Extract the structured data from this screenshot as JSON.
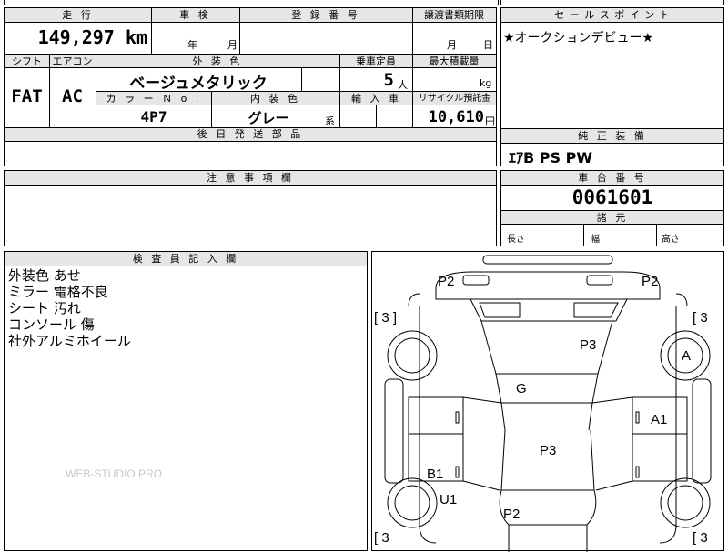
{
  "top_strip": {
    "cut_text": "輸入車"
  },
  "mileage": {
    "header": "走 行",
    "value": "149,297",
    "unit": "km"
  },
  "inspection": {
    "header": "車 検",
    "year_label": "年",
    "month_label": "月"
  },
  "registration": {
    "header": "登 録 番 号"
  },
  "transfer": {
    "header": "譲渡書類期限",
    "month_label": "月",
    "day_label": "日"
  },
  "sales_point": {
    "header": "セ ー ル ス ポ イ ン ト",
    "text": "★オークションデビュー★"
  },
  "shift": {
    "header": "シフト",
    "value": "FAT"
  },
  "aircon": {
    "header": "エアコン",
    "value": "AC"
  },
  "exterior_color": {
    "header": "外 装 色",
    "value": "ベージュメタリック"
  },
  "capacity": {
    "header": "乗車定員",
    "value": "5",
    "unit": "人"
  },
  "max_load": {
    "header": "最大積載量",
    "unit": "kg"
  },
  "color_no": {
    "header": "カ ラ ー Ｎ o .",
    "value": "4P7"
  },
  "interior_color": {
    "header": "内 装 色",
    "value": "グレー",
    "suffix": "系"
  },
  "import_car": {
    "header": "輸 入 車"
  },
  "recycle": {
    "header": "リサイクル預託金",
    "value": "10,610",
    "unit": "円"
  },
  "parts_later": {
    "header": "後 日 発 送 部 品"
  },
  "genuine_equip": {
    "header": "純 正 装 備",
    "value": "ｴｱB PS PW"
  },
  "notes": {
    "header": "注 意 事 項 欄"
  },
  "chassis": {
    "header": "車 台 番 号",
    "value": "0061601"
  },
  "dimensions": {
    "header": "諸 元",
    "length": "長さ",
    "width": "幅",
    "height": "高さ"
  },
  "inspector": {
    "header": "検 査 員 記 入 欄",
    "lines": [
      "外装色 あせ",
      "ミラー 電格不良",
      "シート 汚れ",
      "コンソール 傷",
      "社外アルミホイール"
    ]
  },
  "watermark": "WEB-STUDIO.PRO",
  "diagram": {
    "p2_left": "P2",
    "p2_right": "P2",
    "bracket_tl": "[ 3 ]",
    "bracket_tr": "[ 3",
    "bracket_bl": "[ 3",
    "bracket_br": "[ 3",
    "p3_top": "P3",
    "a": "A",
    "g": "G",
    "a1": "A1",
    "p3_mid": "P3",
    "b1": "B1",
    "u1": "U1",
    "p2_bottom": "P2"
  }
}
